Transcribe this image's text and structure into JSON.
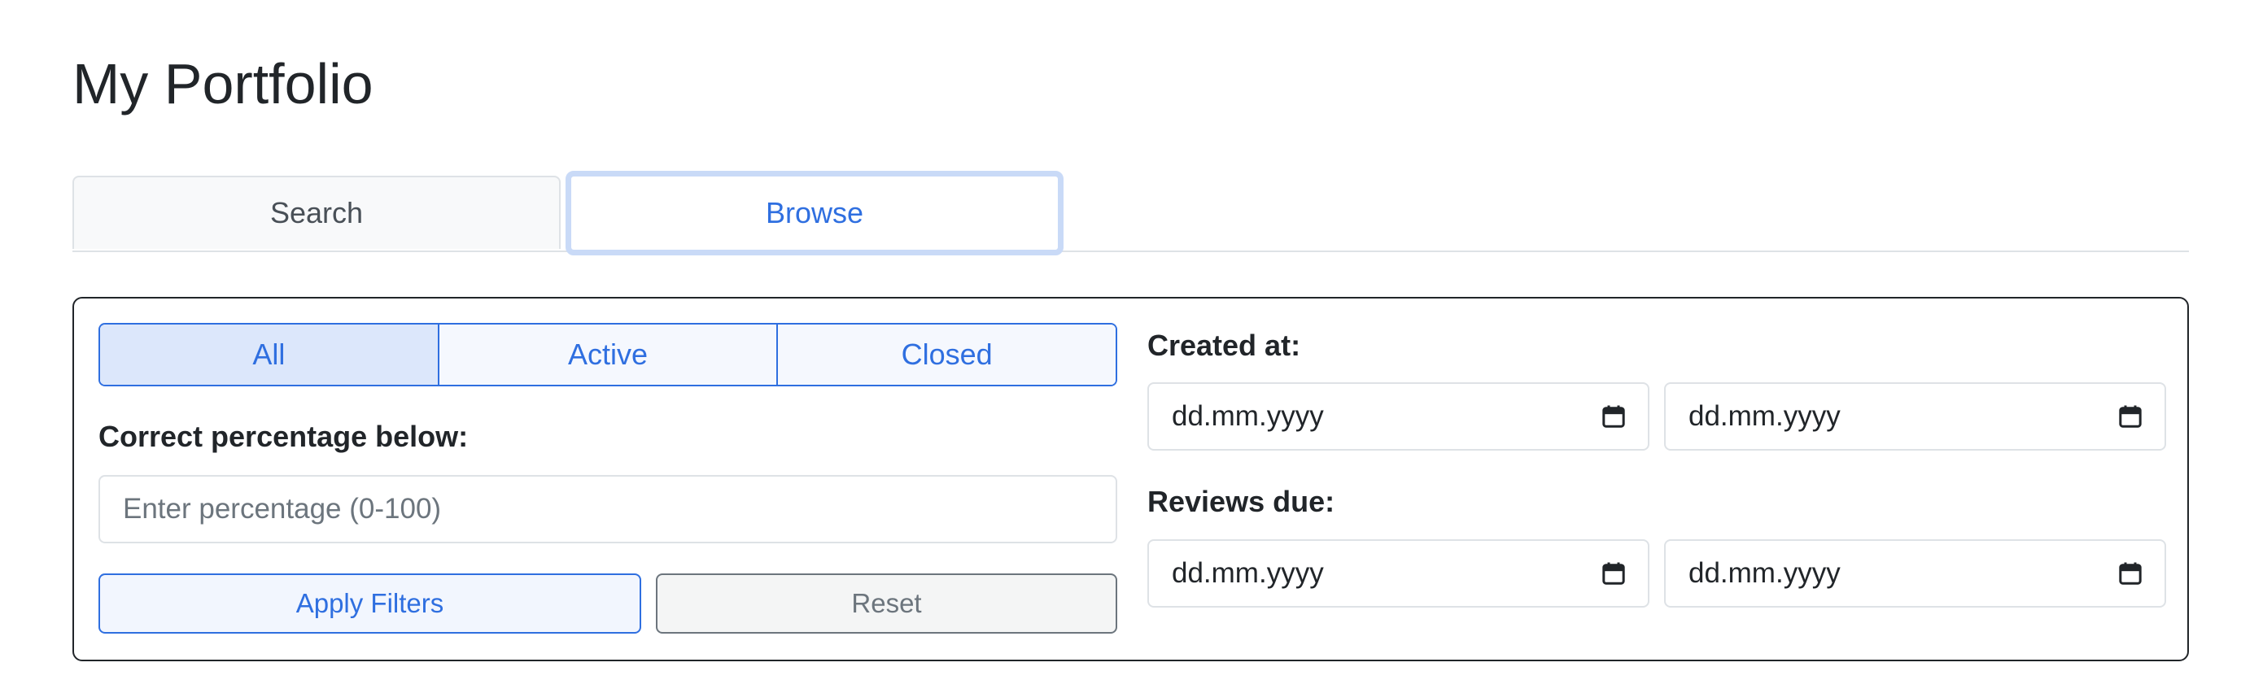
{
  "header": {
    "title": "My Portfolio"
  },
  "tabs": [
    {
      "label": "Search",
      "active": false
    },
    {
      "label": "Browse",
      "active": true
    }
  ],
  "filters": {
    "status_options": [
      {
        "label": "All",
        "selected": true
      },
      {
        "label": "Active",
        "selected": false
      },
      {
        "label": "Closed",
        "selected": false
      }
    ],
    "percentage": {
      "label": "Correct percentage below:",
      "placeholder": "Enter percentage (0-100)",
      "value": ""
    },
    "apply_label": "Apply Filters",
    "reset_label": "Reset",
    "created_at": {
      "label": "Created at:",
      "from_placeholder": "dd.mm.yyyy",
      "to_placeholder": "dd.mm.yyyy"
    },
    "reviews_due": {
      "label": "Reviews due:",
      "from_placeholder": "dd.mm.yyyy",
      "to_placeholder": "dd.mm.yyyy"
    }
  },
  "icons": {
    "date_picker": "calendar-icon"
  },
  "colors": {
    "accent": "#2f6fe0",
    "focus_ring": "#c9daf7",
    "border": "#dee2e6",
    "secondary": "#6c757d",
    "text": "#212529"
  }
}
